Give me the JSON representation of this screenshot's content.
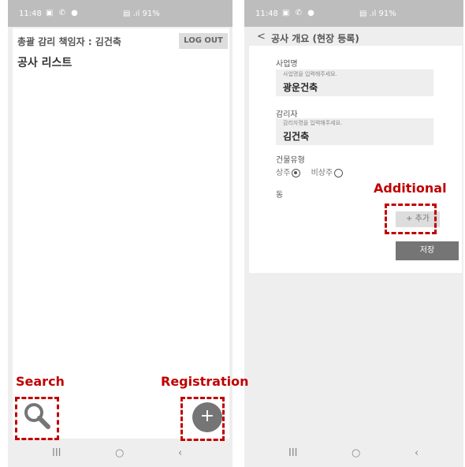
{
  "left_screen": {
    "status": {
      "time": "11:48",
      "indicators": "▣ ✆ ●",
      "signal": "▤ .ıl 91%"
    },
    "supervisor_label": "총괄 감리 책임자 : 김건축",
    "logout_label": "LOG OUT",
    "list_title": "공사 리스트",
    "search_icon": "search-icon",
    "add_icon": "plus-icon",
    "add_symbol": "+",
    "nav": {
      "recent": "III",
      "home": "○",
      "back": "‹"
    }
  },
  "right_screen": {
    "status": {
      "time": "11:48",
      "indicators": "▣ ✆ ●",
      "signal": "▤ .ıl 91%"
    },
    "back_symbol": "<",
    "title": "공사 개요 (현장 등록)",
    "business_label": "사업명",
    "business_placeholder": "사업명을 입력해주세요.",
    "business_value": "광운건축",
    "supervisor_label": "감리자",
    "supervisor_placeholder": "감리자명을 입력해주세요.",
    "supervisor_value": "김건축",
    "building_type_label": "건물유형",
    "option_resident": "상주",
    "option_nonresident": "비상주",
    "selected_option": "상주",
    "dong_label": "동",
    "add_label": "+ 추가",
    "save_label": "저장",
    "nav": {
      "recent": "III",
      "home": "○",
      "back": "‹"
    }
  },
  "annotations": {
    "search": "Search",
    "registration": "Registration",
    "additional": "Additional"
  },
  "colors": {
    "annotation": "#c00000",
    "fab": "#757575",
    "save": "#757575"
  }
}
